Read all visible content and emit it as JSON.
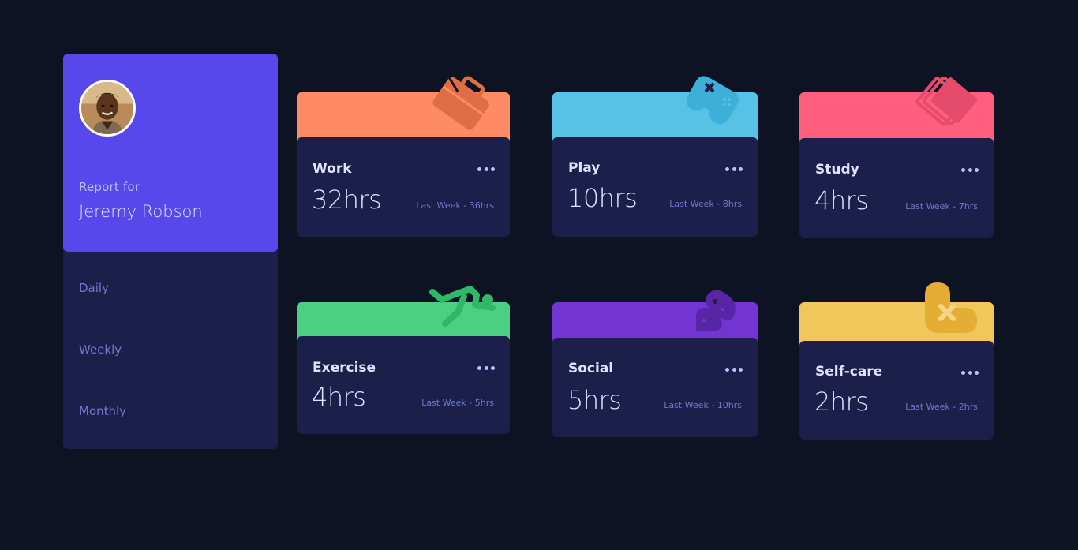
{
  "profile": {
    "report_for": "Report for",
    "name": "Jeremy Robson"
  },
  "periods": {
    "daily": "Daily",
    "weekly": "Weekly",
    "monthly": "Monthly"
  },
  "cards": {
    "work": {
      "title": "Work",
      "hours": "32hrs",
      "previous": "Last Week - 36hrs",
      "icon": "briefcase-icon",
      "color": "#ff8b64"
    },
    "play": {
      "title": "Play",
      "hours": "10hrs",
      "previous": "Last Week - 8hrs",
      "icon": "gamepad-icon",
      "color": "#55c2e6"
    },
    "study": {
      "title": "Study",
      "hours": "4hrs",
      "previous": "Last Week - 7hrs",
      "icon": "books-icon",
      "color": "#ff5e7d"
    },
    "exercise": {
      "title": "Exercise",
      "hours": "4hrs",
      "previous": "Last Week - 5hrs",
      "icon": "running-person-icon",
      "color": "#4bcf82"
    },
    "social": {
      "title": "Social",
      "hours": "5hrs",
      "previous": "Last Week - 10hrs",
      "icon": "chat-bubbles-icon",
      "color": "#7335d2"
    },
    "selfcare": {
      "title": "Self-care",
      "hours": "2hrs",
      "previous": "Last Week - 2hrs",
      "icon": "heart-bandage-icon",
      "color": "#f1c75b"
    }
  }
}
